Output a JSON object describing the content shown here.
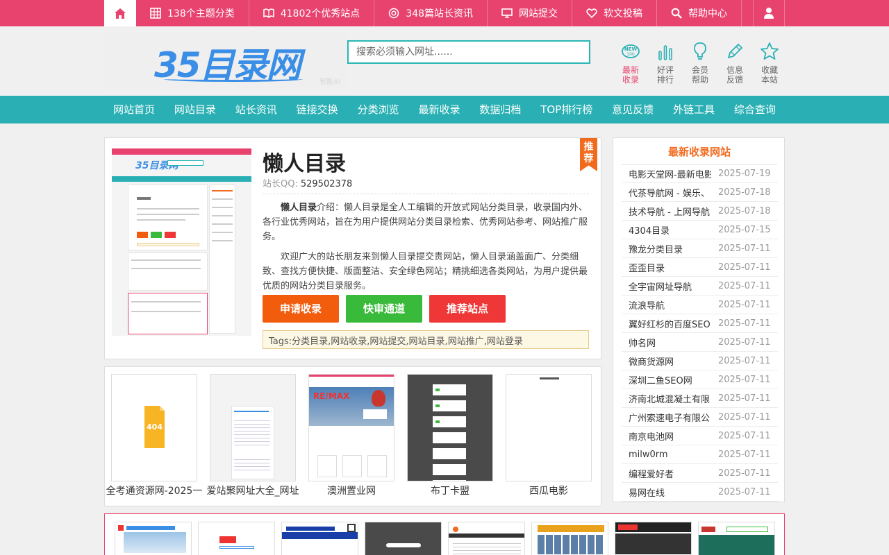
{
  "topbar": {
    "items": [
      {
        "label": "138个主题分类",
        "icon": "grid-icon"
      },
      {
        "label": "41802个优秀站点",
        "icon": "book-icon"
      },
      {
        "label": "348篇站长资讯",
        "icon": "circle-dot-icon"
      },
      {
        "label": "网站提交",
        "icon": "monitor-icon"
      },
      {
        "label": "软文投稿",
        "icon": "heart-icon"
      },
      {
        "label": "帮助中心",
        "icon": "search-icon"
      }
    ]
  },
  "header": {
    "logo_text": "35目录网",
    "logo_badge": "智能AI",
    "search_placeholder": "搜索必须输入网址......",
    "icons": [
      {
        "label": "最新收录",
        "icon": "new-icon"
      },
      {
        "label": "好评排行",
        "icon": "bar-chart-icon"
      },
      {
        "label": "会员帮助",
        "icon": "lightbulb-icon"
      },
      {
        "label": "信息反馈",
        "icon": "pencil-icon"
      },
      {
        "label": "收藏本站",
        "icon": "star-icon"
      }
    ]
  },
  "nav": [
    "网站首页",
    "网站目录",
    "站长资讯",
    "链接交换",
    "分类浏览",
    "最新收录",
    "数据归档",
    "TOP排行榜",
    "意见反馈",
    "外链工具",
    "综合查询"
  ],
  "detail": {
    "title": "懒人目录",
    "ribbon": "推荐",
    "qq_label": "站长QQ:",
    "qq_value": "529502378",
    "intro_name": "懒人目录",
    "intro_text": "介绍：懒人目录是全人工编辑的开放式网站分类目录，收录国内外、各行业优秀网站，旨在为用户提供网站分类目录检索、优秀网站参考、网站推广服务。",
    "paragraph2": "欢迎广大的站长朋友来到懒人目录提交贵网站，懒人目录涵盖面广、分类细致、查找方便快捷、版面整洁、安全绿色网站；精挑细选各类网站，为用户提供最优质的网站分类目录服务。",
    "buttons": [
      "申请收录",
      "快审通道",
      "推荐站点"
    ],
    "tags": "Tags:分类目录,网站收录,网站提交,网站目录,网站推广,网站登录"
  },
  "thumbnails": [
    {
      "label": "全考通资源网-2025一"
    },
    {
      "label": "爱站聚网址大全_网址"
    },
    {
      "label": "澳洲置业网"
    },
    {
      "label": "布丁卡盟"
    },
    {
      "label": "西瓜电影"
    }
  ],
  "sidebar": {
    "title": "最新收录网站",
    "items": [
      {
        "name": "电影天堂网-最新电影-",
        "date": "2025-07-19"
      },
      {
        "name": "代茶导航网 - 娱乐、",
        "date": "2025-07-18"
      },
      {
        "name": "技术导航 - 上网导航",
        "date": "2025-07-18"
      },
      {
        "name": "4304目录",
        "date": "2025-07-15"
      },
      {
        "name": "豫龙分类目录",
        "date": "2025-07-11"
      },
      {
        "name": "歪歪目录",
        "date": "2025-07-11"
      },
      {
        "name": "全宇宙网址导航",
        "date": "2025-07-11"
      },
      {
        "name": "流浪导航",
        "date": "2025-07-11"
      },
      {
        "name": "翼好红杉的百度SEO",
        "date": "2025-07-11"
      },
      {
        "name": "帅名网",
        "date": "2025-07-11"
      },
      {
        "name": "微商货源网",
        "date": "2025-07-11"
      },
      {
        "name": "深圳二鱼SEO网",
        "date": "2025-07-11"
      },
      {
        "name": "济南北城混凝土有限",
        "date": "2025-07-11"
      },
      {
        "name": "广州索速电子有限公",
        "date": "2025-07-11"
      },
      {
        "name": "南京电池网",
        "date": "2025-07-11"
      },
      {
        "name": "milw0rm",
        "date": "2025-07-11"
      },
      {
        "name": "编程爱好者",
        "date": "2025-07-11"
      },
      {
        "name": "易网在线",
        "date": "2025-07-11"
      }
    ]
  },
  "colors": {
    "pink": "#e8436f",
    "teal": "#2ab0b4",
    "orange": "#f26a1e",
    "green": "#3aba3a",
    "red": "#ef3737"
  }
}
